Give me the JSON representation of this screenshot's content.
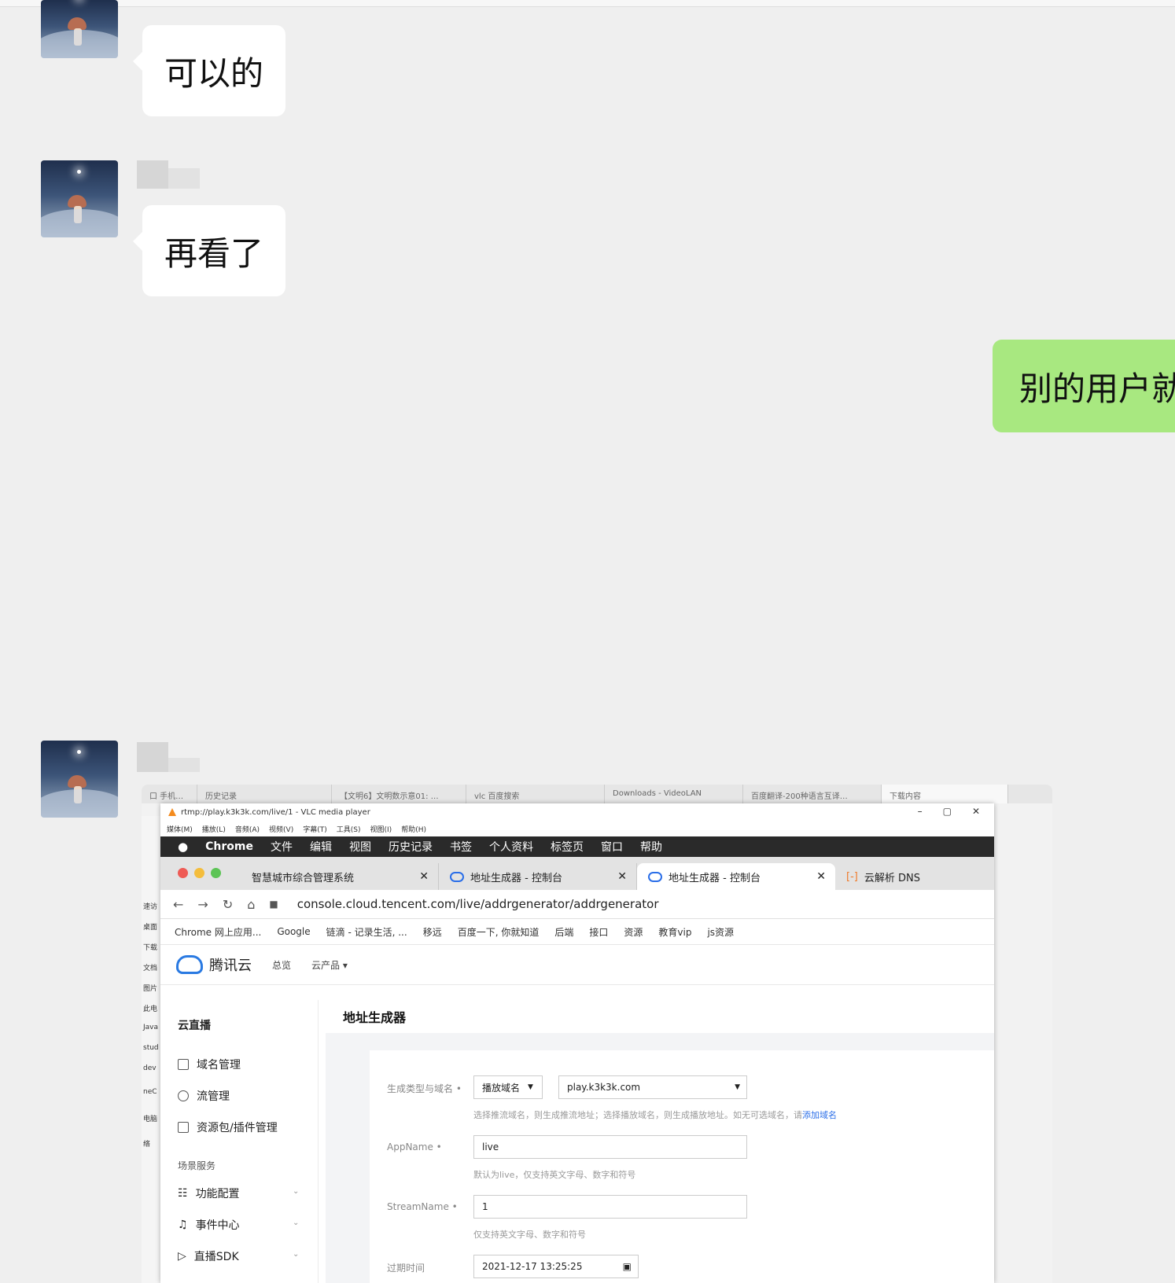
{
  "messages": [
    {
      "side": "left",
      "text": "可以的"
    },
    {
      "side": "left",
      "text": "再看了"
    },
    {
      "side": "right",
      "text": "别的用户就"
    }
  ],
  "screenshot": {
    "outer_tabs": [
      "口 手机…",
      "历史记录",
      "【文明6】文明数示意01: …",
      "vlc 百度搜索",
      "Downloads - VideoLAN",
      "百度翻译-200种语言互译…",
      "下载内容"
    ],
    "left_fragments": [
      "速访",
      "桌面",
      "下载",
      "文档",
      "图片",
      "此电",
      "Java",
      "stud",
      "dev",
      "neC",
      "电脑",
      "络"
    ],
    "vlc_title": "rtmp://play.k3k3k.com/live/1 - VLC media player",
    "vlc_menu": [
      "媒体(M)",
      "播放(L)",
      "音频(A)",
      "视频(V)",
      "字幕(T)",
      "工具(S)",
      "视图(I)",
      "帮助(H)"
    ],
    "mac_menu": [
      "Chrome",
      "文件",
      "编辑",
      "视图",
      "历史记录",
      "书签",
      "个人资料",
      "标签页",
      "窗口",
      "帮助"
    ],
    "chrome_tabs": [
      {
        "label": "智慧城市综合管理系统"
      },
      {
        "label": "地址生成器 - 控制台"
      },
      {
        "label": "地址生成器 - 控制台"
      },
      {
        "label": "云解析 DNS"
      }
    ],
    "url": "console.cloud.tencent.com/live/addrgenerator/addrgenerator",
    "bookmarks": [
      "Chrome 网上应用...",
      "Google",
      "链滴 - 记录生活, ...",
      "移远",
      "百度一下, 你就知道",
      "后端",
      "接口",
      "资源",
      "教育vip",
      "js资源"
    ],
    "tc": {
      "logo": "腾讯云",
      "nav": [
        "总览",
        "云产品 ▾"
      ],
      "page_title": "地址生成器",
      "sidebar": {
        "title": "云直播",
        "items": [
          "域名管理",
          "流管理",
          "资源包/插件管理"
        ],
        "section": "场景服务",
        "items2": [
          "功能配置",
          "事件中心",
          "直播SDK"
        ]
      },
      "form": {
        "type_label": "生成类型与域名 •",
        "type_value": "播放域名",
        "domain_value": "play.k3k3k.com",
        "type_hint": "选择推流域名，则生成推流地址；选择播放域名，则生成播放地址。如无可选域名，请",
        "type_hint_link": "添加域名",
        "app_label": "AppName •",
        "app_value": "live",
        "app_hint": "默认为live，仅支持英文字母、数字和符号",
        "stream_label": "StreamName •",
        "stream_value": "1",
        "stream_hint": "仅支持英文字母、数字和符号",
        "expire_label": "过期时间",
        "expire_value": "2021-12-17 13:25:25"
      }
    }
  }
}
